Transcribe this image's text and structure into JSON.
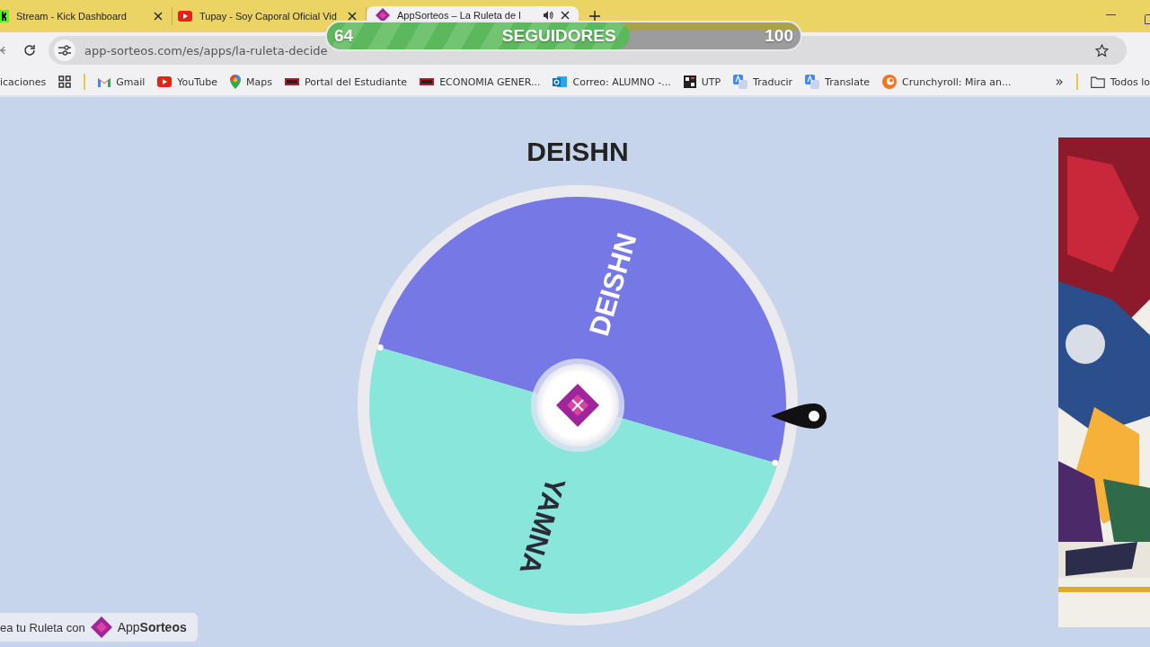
{
  "tabs": [
    {
      "title": "Stream - Kick Dashboard",
      "audio": false,
      "selected": false
    },
    {
      "title": "Tupay - Soy Caporal Oficial Vid",
      "audio": false,
      "selected": false
    },
    {
      "title": "AppSorteos – La Ruleta de l",
      "audio": true,
      "selected": true
    }
  ],
  "address_bar": {
    "url": "app-sorteos.com/es/apps/la-ruleta-decide"
  },
  "bookmarks": [
    {
      "label": "icaciones"
    },
    {
      "label": "Gmail"
    },
    {
      "label": "YouTube"
    },
    {
      "label": "Maps"
    },
    {
      "label": "Portal del Estudiante"
    },
    {
      "label": "ECONOMIA GENER..."
    },
    {
      "label": "Correo: ALUMNO -..."
    },
    {
      "label": "UTP"
    },
    {
      "label": "Traducir"
    },
    {
      "label": "Translate"
    },
    {
      "label": "Crunchyroll: Mira an..."
    }
  ],
  "bookmarks_overflow": {
    "label": "»"
  },
  "bookmarks_folder": {
    "label": "Todos lo"
  },
  "follower_goal": {
    "current": "64",
    "label": "SEGUIDORES",
    "target": "100",
    "level": 0.64
  },
  "winner": "DEISHN",
  "wheel": {
    "segments": [
      {
        "label": "DEISHN",
        "color": "#7678e6"
      },
      {
        "label": "YAMNA",
        "color": "#89e6db"
      }
    ]
  },
  "footer_badge": {
    "text": "ea tu Ruleta con",
    "brand": "App**Sorteos**"
  }
}
